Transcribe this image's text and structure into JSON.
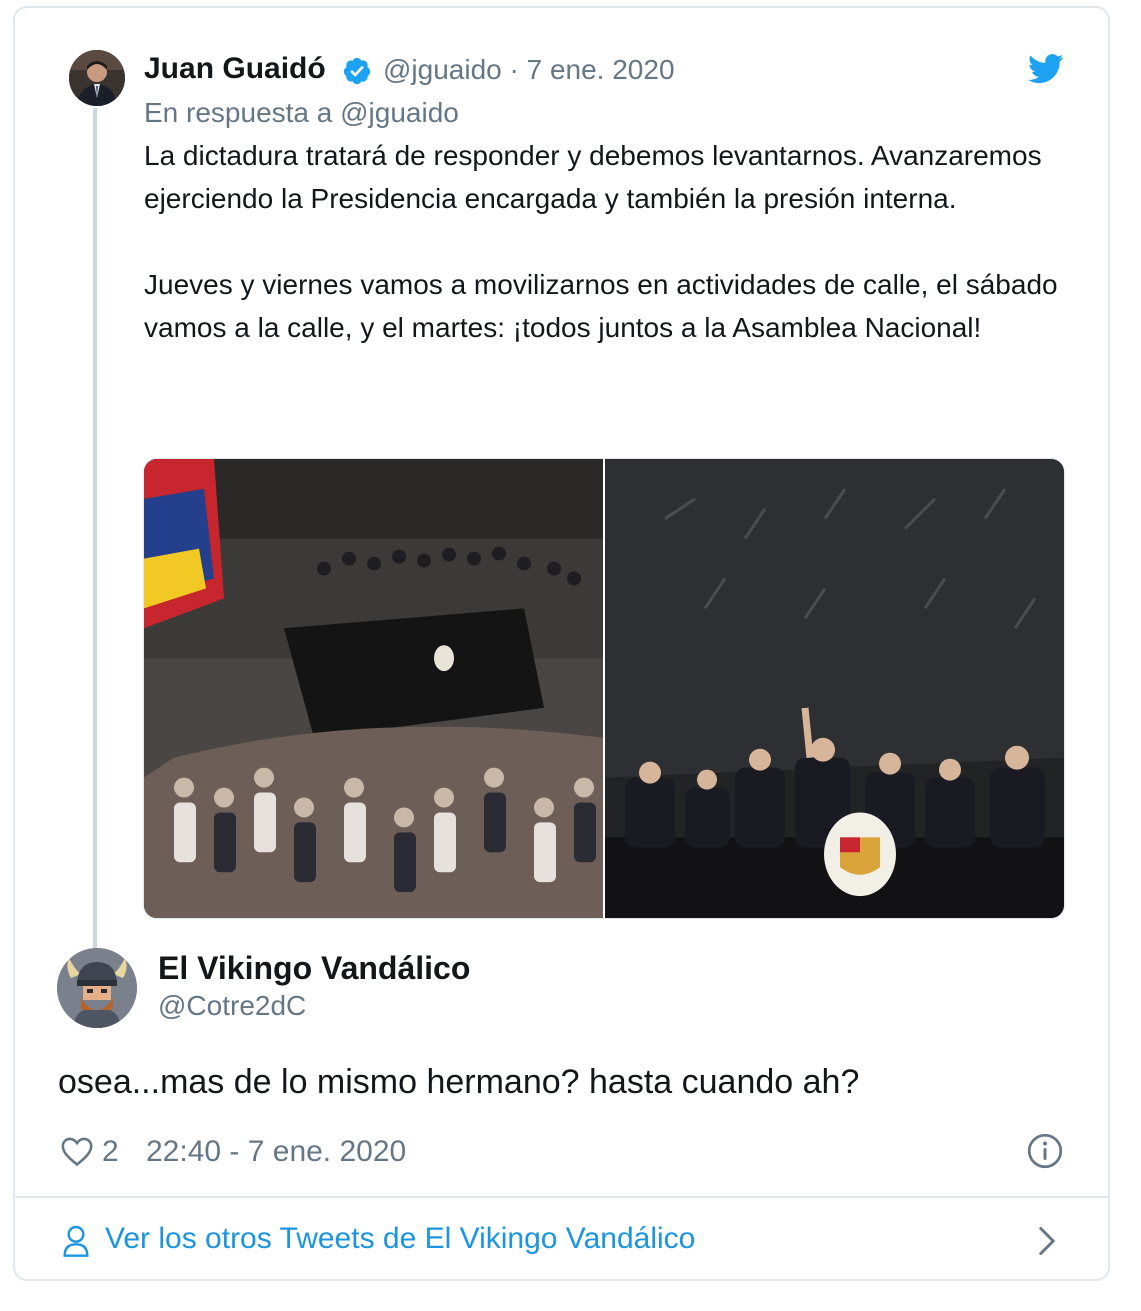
{
  "original_tweet": {
    "author_name": "Juan Guaidó",
    "author_handle_date": "@jguaido · 7 ene. 2020",
    "reply_to": "En respuesta a @jguaido",
    "text": "La dictadura tratará de responder y debemos levantarnos. Avanzaremos ejerciendo la Presidencia encargada y también la presión interna.\n\nJueves y viernes vamos a movilizarnos en actividades de calle, el sábado vamos a la calle, y el martes: ¡todos juntos a la Asamblea Nacional!",
    "photos": [
      "assembly-crowd-photo",
      "assembly-stage-photo"
    ]
  },
  "reply_tweet": {
    "author_name": "El Vikingo Vandálico",
    "author_handle": "@Cotre2dC",
    "text": "osea...mas de lo mismo hermano? hasta cuando ah?",
    "like_count": "2",
    "timestamp": "22:40 - 7 ene. 2020"
  },
  "footer": {
    "more_tweets_link": "Ver los otros Tweets de El Vikingo Vandálico"
  },
  "icons": [
    "verified-icon",
    "twitter-bird-icon",
    "heart-icon",
    "info-icon",
    "person-icon",
    "chevron-right-icon"
  ],
  "colors": {
    "twitter_blue": "#1da1f2",
    "link_blue": "#1b95e0",
    "secondary_text": "#657786",
    "border": "#e1e8ed"
  }
}
